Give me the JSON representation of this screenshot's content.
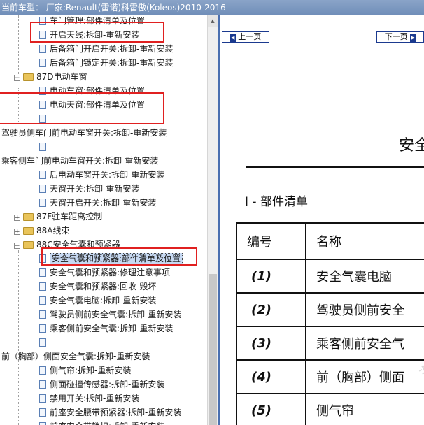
{
  "window": {
    "title": "当前车型： 厂家:Renault(雷诺)科雷傲(Koleos)2010-2016"
  },
  "tree": {
    "items": [
      {
        "label": "车门管理:部件清单及位置",
        "type": "doc"
      },
      {
        "label": "开启天线:拆卸-重新安装",
        "type": "doc"
      },
      {
        "label": "后备箱门开启开关:拆卸-重新安装",
        "type": "doc"
      },
      {
        "label": "后备箱门锁定开关:拆卸-重新安装",
        "type": "doc"
      },
      {
        "label": "87D电动车窗",
        "type": "folder-open"
      },
      {
        "label": "电动车窗:部件清单及位置",
        "type": "doc"
      },
      {
        "label": "电动天窗:部件清单及位置",
        "type": "doc"
      },
      {
        "label": "",
        "type": "doc"
      },
      {
        "label": "驾驶员侧车门前电动车窗开关:拆卸-重新安装",
        "type": "text"
      },
      {
        "label": "",
        "type": "doc"
      },
      {
        "label": "乘客侧车门前电动车窗开关:拆卸-重新安装",
        "type": "text"
      },
      {
        "label": "后电动车窗开关:拆卸-重新安装",
        "type": "doc"
      },
      {
        "label": "天窗开关:拆卸-重新安装",
        "type": "doc"
      },
      {
        "label": "天窗开启开关:拆卸-重新安装",
        "type": "doc"
      },
      {
        "label": "87F驻车距离控制",
        "type": "folder-closed"
      },
      {
        "label": "88A线束",
        "type": "folder-closed"
      },
      {
        "label": "88C安全气囊和预紧器",
        "type": "folder-open"
      },
      {
        "label": "安全气囊和预紧器:部件清单及位置",
        "type": "doc-selected"
      },
      {
        "label": "安全气囊和预紧器:修理注意事项",
        "type": "doc"
      },
      {
        "label": "安全气囊和预紧器:回收-毁坏",
        "type": "doc"
      },
      {
        "label": "安全气囊电脑:拆卸-重新安装",
        "type": "doc"
      },
      {
        "label": "驾驶员侧前安全气囊:拆卸-重新安装",
        "type": "doc"
      },
      {
        "label": "乘客侧前安全气囊:拆卸-重新安装",
        "type": "doc"
      },
      {
        "label": "",
        "type": "doc"
      },
      {
        "label": "前（胸部）侧面安全气囊:拆卸-重新安装",
        "type": "text"
      },
      {
        "label": "侧气帘:拆卸-重新安装",
        "type": "doc"
      },
      {
        "label": "侧面碰撞传感器:拆卸-重新安装",
        "type": "doc"
      },
      {
        "label": "禁用开关:拆卸-重新安装",
        "type": "doc"
      },
      {
        "label": "前座安全腰带预紧器:拆卸-重新安装",
        "type": "doc"
      },
      {
        "label": "前座安全带锁扣:拆卸-重新安装",
        "type": "doc"
      }
    ]
  },
  "viewer": {
    "prev_label": "上一页",
    "next_label": "下一页",
    "heading": "安全",
    "section_title": "I - 部件清单",
    "table": {
      "headers": [
        "编号",
        "名称"
      ],
      "rows": [
        {
          "num": "(1)",
          "name": "安全气囊电脑"
        },
        {
          "num": "(2)",
          "name": "驾驶员侧前安全"
        },
        {
          "num": "(3)",
          "name": "乘客侧前安全气"
        },
        {
          "num": "(4)",
          "name": "前（胸部）侧面"
        },
        {
          "num": "(5)",
          "name": "侧气帘"
        }
      ]
    },
    "watermark": "汽车维修 388"
  },
  "colors": {
    "annotation": "#e02020",
    "selection": "#c7d9f2",
    "splitter": "#4a6fb0"
  }
}
